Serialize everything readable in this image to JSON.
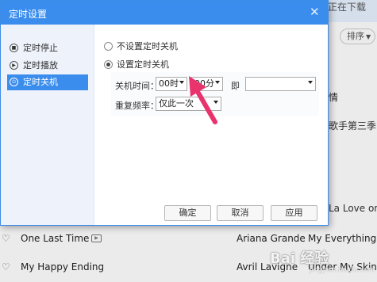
{
  "background": {
    "download_label": "正在下载",
    "sort_label": "排序",
    "right_texts": [
      "情",
      "歌手第三季 第",
      "La Love on I"
    ],
    "rows": [
      {
        "title": "One Last Time",
        "artist": "Ariana Grande",
        "album": "My Everything"
      },
      {
        "title": "My Happy Ending",
        "artist": "Avril Lavigne",
        "album": "Under My Skin"
      }
    ]
  },
  "dialog": {
    "title": "定时设置",
    "sidebar": [
      {
        "label": "定时停止",
        "icon": "timer-stop-icon"
      },
      {
        "label": "定时播放",
        "icon": "timer-play-icon"
      },
      {
        "label": "定时关机",
        "icon": "power-icon",
        "active": true
      }
    ],
    "options": {
      "no_shutdown": "不设置定时关机",
      "set_shutdown": "设置定时关机",
      "selected": "set_shutdown"
    },
    "shutdown_time_label": "关机时间：",
    "hour_value": "00时",
    "minute_value": "00分",
    "that_is_label": "即",
    "date_value": "",
    "repeat_label": "重复频率：",
    "repeat_value": "仅此一次",
    "buttons": {
      "ok": "确定",
      "cancel": "取消",
      "apply": "应用"
    }
  },
  "watermark": {
    "logo_text": "Bai 经验",
    "sub_text": "jingyan.baidu.com"
  },
  "colors": {
    "accent": "#3b8ded",
    "annotation_arrow": "#e8336d"
  }
}
